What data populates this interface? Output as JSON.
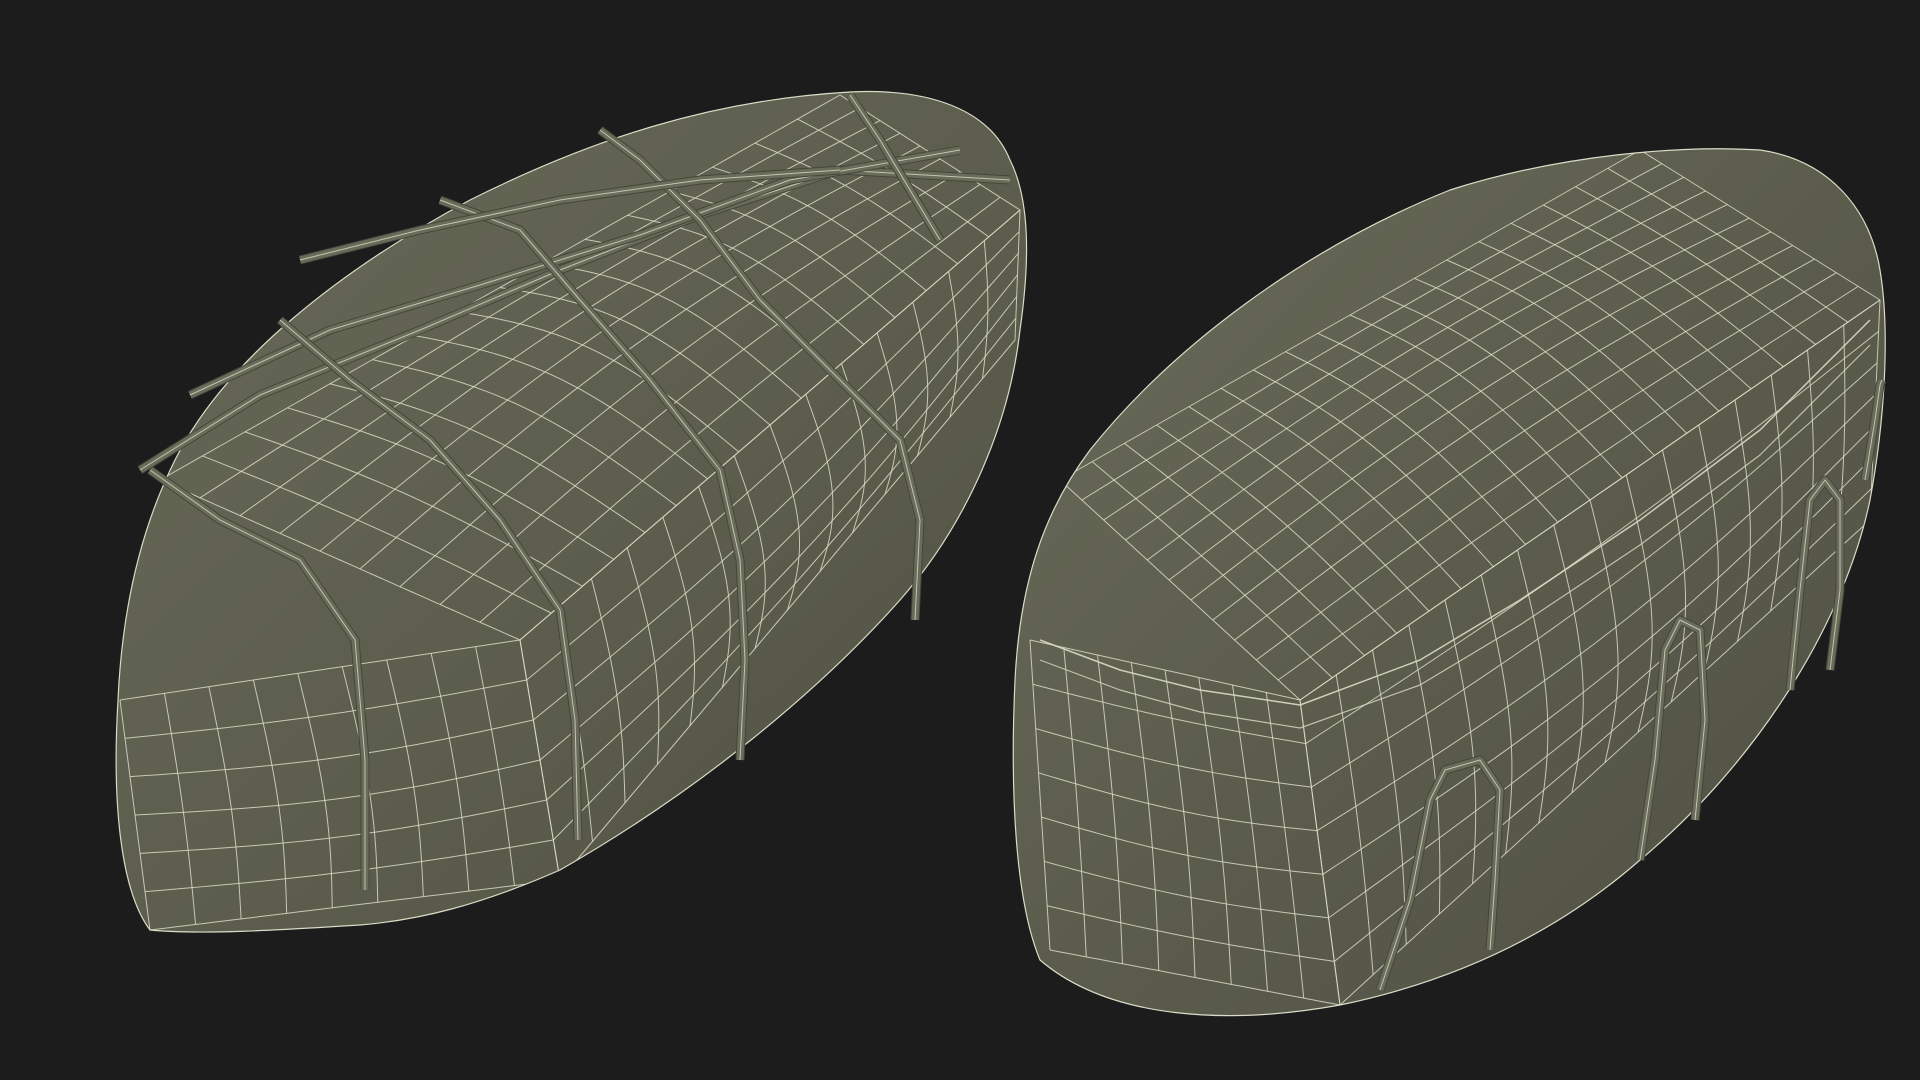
{
  "scene": {
    "background_color": "#1c1c1c",
    "mesh_fill": "#5b5c4c",
    "mesh_shade": "#4a4b3e",
    "mesh_highlight": "#686a58",
    "wire_color": "#d9dcc6",
    "rope_color": "#6a6c5a",
    "display_mode": "wireframe-on-shaded"
  },
  "objects": [
    {
      "name": "bundle-with-rope-lashing",
      "render": "wireframe-on-shaded"
    },
    {
      "name": "bundle-lid-top-view",
      "render": "wireframe-on-shaded"
    }
  ]
}
